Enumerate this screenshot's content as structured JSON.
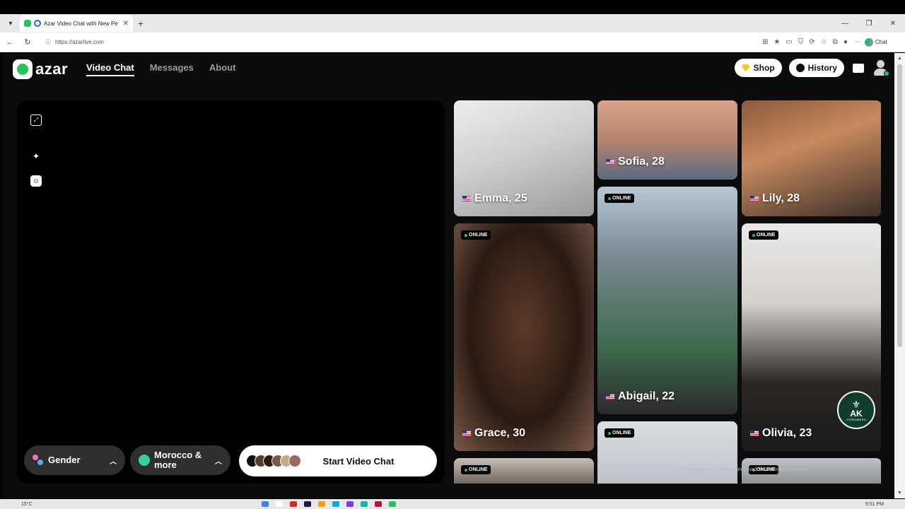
{
  "browser": {
    "tab_title": "Azar Video Chat with New Pe",
    "url": "https://azarlive.com",
    "chat_label": "Chat",
    "new_tab_symbol": "+",
    "close_symbol": "✕"
  },
  "header": {
    "logo_text": "azar",
    "nav": [
      {
        "label": "Video Chat",
        "active": true
      },
      {
        "label": "Messages",
        "active": false
      },
      {
        "label": "About",
        "active": false
      }
    ],
    "shop_label": "Shop",
    "history_label": "History"
  },
  "video_panel": {
    "tools": [
      "expand-icon",
      "magic-wand-icon",
      "face-filter-icon"
    ],
    "gender_label": "Gender",
    "region_label": "Morocco & more",
    "start_label": "Start Video Chat"
  },
  "profiles": [
    {
      "name": "Emma, 25",
      "online": false,
      "bg": "linear-gradient(160deg,#eeeeee 0%,#cfcfcf 45%,#9a9a9a 100%)"
    },
    {
      "name": "Sofia, 28",
      "online": false,
      "bg": "linear-gradient(180deg,#d9a48a 0%,#b6846d 50%,#5c6b80 100%)"
    },
    {
      "name": "Lily, 28",
      "online": false,
      "bg": "linear-gradient(160deg,#8c5a3c 0%,#c78a5e 40%,#3b2e28 100%)"
    },
    {
      "name": "Grace, 30",
      "online": true,
      "bg": "radial-gradient(ellipse at 50% 45%,#5b3a28 0%,#2a1a12 55%,#7a5a4a 100%)"
    },
    {
      "name": "Abigail, 22",
      "online": true,
      "bg": "linear-gradient(180deg,#b8c7d4 0%,#7b8a94 30%,#3e6b4e 70%,#2b2b2b 100%)"
    },
    {
      "name": "Olivia, 23",
      "online": true,
      "bg": "linear-gradient(180deg,#e9e9e9 0%,#d5d1cd 35%,#2b2724 70%,#1b1b1b 100%)"
    },
    {
      "name": "",
      "online": true,
      "bg": "linear-gradient(180deg,#c6bfb7 0%,#3a2b23 100%)"
    },
    {
      "name": "",
      "online": true,
      "bg": "linear-gradient(180deg,#d9dee2 0%,#b4bbc1 100%)"
    },
    {
      "name": "",
      "online": true,
      "bg": "linear-gradient(180deg,#bfc2c6 0%,#6b6f73 100%)"
    }
  ],
  "online_badge": "ONLINE",
  "notice": "All images are of models and used for illustrative purposes.",
  "watermark": {
    "letters": "AK",
    "sub": "STREAMERS"
  },
  "taskbar": {
    "weather": "15°C",
    "time": "9:51 PM"
  }
}
